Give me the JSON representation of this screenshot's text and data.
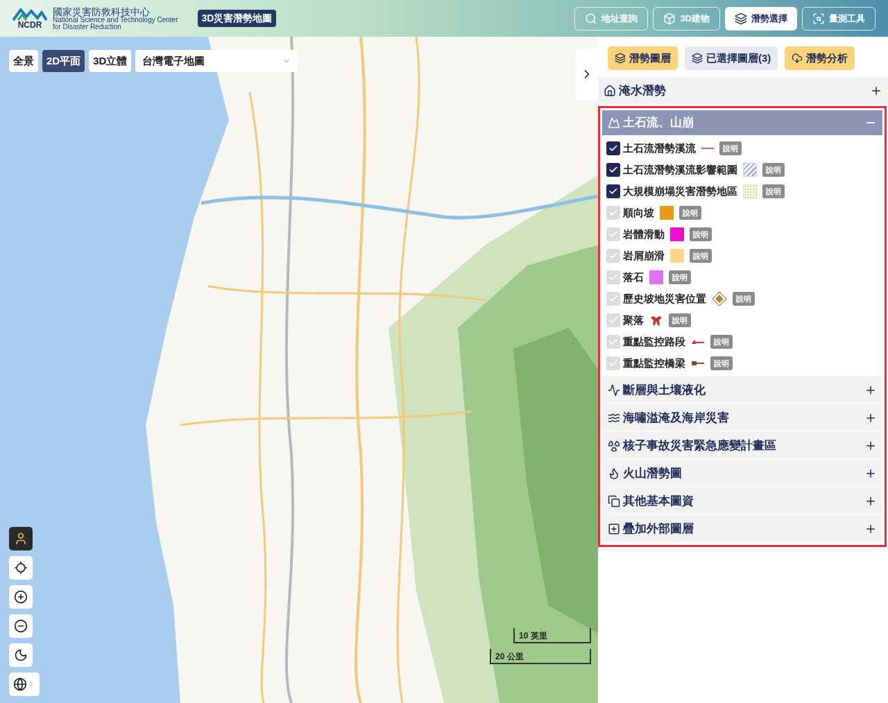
{
  "header": {
    "org_name": "國家災害防救科技中心",
    "org_name_en": "National Science and Technology Center",
    "org_name_en2": "for Disaster Reduction",
    "logo_text": "NCDR",
    "app_title": "3D災害潛勢地圖",
    "nav": [
      {
        "label": "地址查詢",
        "selected": false
      },
      {
        "label": "3D建物",
        "selected": false
      },
      {
        "label": "潛勢選擇",
        "selected": true
      },
      {
        "label": "量測工具",
        "selected": false
      }
    ]
  },
  "map": {
    "views": [
      {
        "label": "全景",
        "selected": false
      },
      {
        "label": "2D平面",
        "selected": true
      },
      {
        "label": "3D立體",
        "selected": false
      }
    ],
    "basemap": "台灣電子地圖",
    "controls": [
      {
        "kind": "person",
        "selected": true
      },
      {
        "kind": "locate",
        "selected": false
      },
      {
        "kind": "zoom-in",
        "selected": false
      },
      {
        "kind": "zoom-out",
        "selected": false
      },
      {
        "kind": "dark",
        "selected": false
      },
      {
        "kind": "globe",
        "selected": false
      }
    ],
    "scale": [
      "10 英里",
      "20 公里"
    ]
  },
  "panel": {
    "tabs": [
      {
        "label": "潛勢圖層",
        "color": "#fcd27a"
      },
      {
        "label": "已選擇圖層(3)",
        "color": "#e6e9f1"
      },
      {
        "label": "潛勢分析",
        "color": "#fcd27a"
      }
    ],
    "sections": [
      {
        "title": "淹水潛勢",
        "expanded": false
      },
      {
        "title": "土石流、山崩",
        "expanded": true,
        "highlighted": true,
        "items": [
          {
            "label": "土石流潛勢溪流",
            "checked": true,
            "legend": {
              "kind": "line",
              "color": "#b760c8"
            },
            "info": "說明"
          },
          {
            "label": "土石流潛勢溪流影響範圍",
            "checked": true,
            "legend": {
              "kind": "hatch"
            },
            "info": "說明"
          },
          {
            "label": "大規模崩塌災害潛勢地區",
            "checked": true,
            "legend": {
              "kind": "dots"
            },
            "info": "說明"
          },
          {
            "label": "順向坡",
            "checked": false,
            "legend": {
              "kind": "swatch",
              "color": "#e89a12"
            },
            "info": "說明"
          },
          {
            "label": "岩體滑動",
            "checked": false,
            "legend": {
              "kind": "swatch",
              "color": "#f010c8"
            },
            "info": "說明"
          },
          {
            "label": "岩屑崩滑",
            "checked": false,
            "legend": {
              "kind": "swatch",
              "color": "#fdd68a"
            },
            "info": "說明"
          },
          {
            "label": "落石",
            "checked": false,
            "legend": {
              "kind": "swatch",
              "color": "#dd70f0"
            },
            "info": "說明"
          },
          {
            "label": "歷史坡地災害位置",
            "checked": false,
            "legend": {
              "kind": "diamond"
            },
            "info": "說明"
          },
          {
            "label": "聚落",
            "checked": false,
            "legend": {
              "kind": "settlement"
            },
            "info": "說明"
          },
          {
            "label": "重點監控路段",
            "checked": false,
            "legend": {
              "kind": "road"
            },
            "info": "說明"
          },
          {
            "label": "重點監控橋梁",
            "checked": false,
            "legend": {
              "kind": "bridge"
            },
            "info": "說明"
          }
        ]
      },
      {
        "title": "斷層與土壤液化",
        "expanded": false,
        "highlighted": true
      },
      {
        "title": "海嘯溢淹及海岸災害",
        "expanded": false,
        "highlighted": true
      },
      {
        "title": "核子事故災害緊急應變計畫區",
        "expanded": false,
        "highlighted": true
      },
      {
        "title": "火山潛勢圖",
        "expanded": false,
        "highlighted": true
      },
      {
        "title": "其他基本圖資",
        "expanded": false,
        "highlighted": true
      },
      {
        "title": "疊加外部圖層",
        "expanded": false,
        "highlighted": true
      }
    ]
  }
}
